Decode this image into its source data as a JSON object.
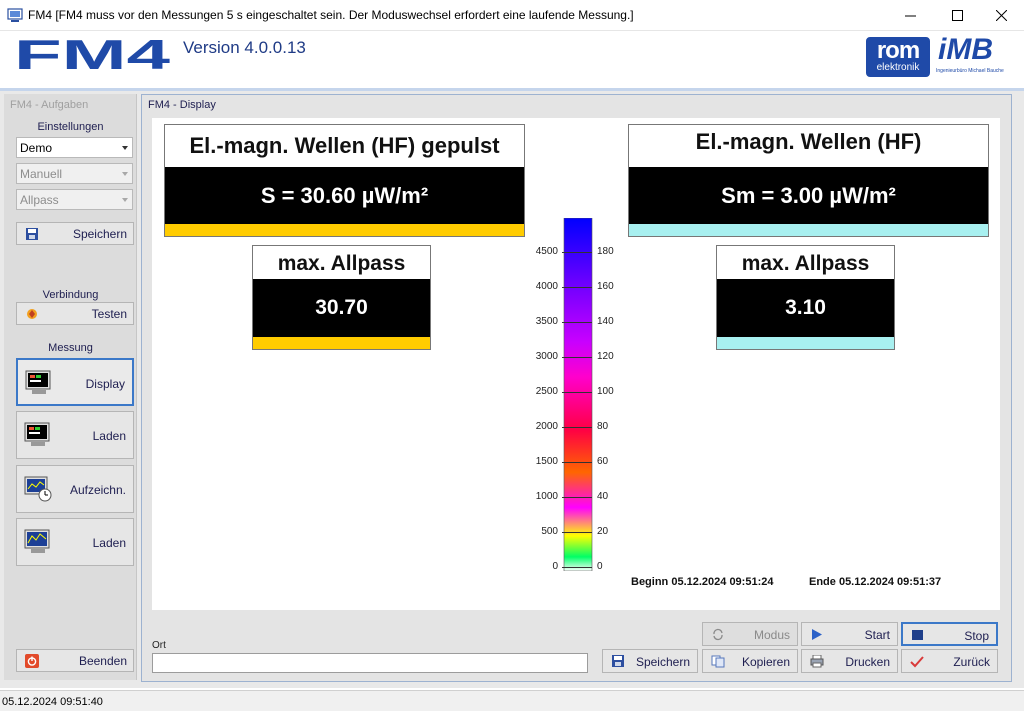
{
  "window": {
    "title": "FM4 [FM4 muss vor den Messungen 5 s eingeschaltet sein. Der Moduswechsel erfordert eine laufende Messung.]",
    "icon": "fm4-app-icon"
  },
  "header": {
    "logo": "FM4",
    "version": "Version 4.0.0.13",
    "rom_logo_top": "rom",
    "rom_logo_bottom": "elektronik",
    "imb_logo": "iMB",
    "imb_subtitle": "Ingenieurbüro Michael Bauche"
  },
  "sidebar": {
    "title": "FM4 - Aufgaben",
    "einstellungen_label": "Einstellungen",
    "combo_mode": "Demo",
    "combo_manual": "Manuell",
    "combo_filter": "Allpass",
    "save_label": "Speichern",
    "verbindung_label": "Verbindung",
    "test_label": "Testen",
    "messung_label": "Messung",
    "display_label": "Display",
    "laden1_label": "Laden",
    "aufzeichn_label": "Aufzeichn.",
    "laden2_label": "Laden",
    "beenden_label": "Beenden"
  },
  "panel": {
    "title": "FM4 - Display",
    "left": {
      "heading": "El.-magn. Wellen (HF) gepulst",
      "value": "S =   30.60 µW/m²",
      "max_heading": "max. Allpass",
      "max_value": "30.70",
      "color": "#ffcc00"
    },
    "right": {
      "heading": "El.-magn. Wellen (HF)",
      "value": "Sm =   3.00 µW/m²",
      "max_heading": "max. Allpass",
      "max_value": "3.10",
      "color": "#a8f0f0"
    },
    "scale_left": [
      "4500",
      "4000",
      "3500",
      "3000",
      "2500",
      "2000",
      "1500",
      "1000",
      "500",
      "0"
    ],
    "scale_right": [
      "180",
      "160",
      "140",
      "120",
      "100",
      "80",
      "60",
      "40",
      "20",
      "0"
    ],
    "beginn": "Beginn 05.12.2024 09:51:24",
    "ende": "Ende 05.12.2024 09:51:37"
  },
  "bottom": {
    "ort_label": "Ort",
    "ort_value": "",
    "modus_label": "Modus",
    "start_label": "Start",
    "stop_label": "Stop",
    "speichern_label": "Speichern",
    "kopieren_label": "Kopieren",
    "drucken_label": "Drucken",
    "zurueck_label": "Zurück"
  },
  "status": {
    "datetime": "05.12.2024 09:51:40"
  },
  "colors": {
    "brand_blue": "#1f4aa8",
    "accent_blue": "#3b78c8",
    "pulsed_strip": "#ffcc00",
    "cont_strip": "#a8f0f0"
  }
}
